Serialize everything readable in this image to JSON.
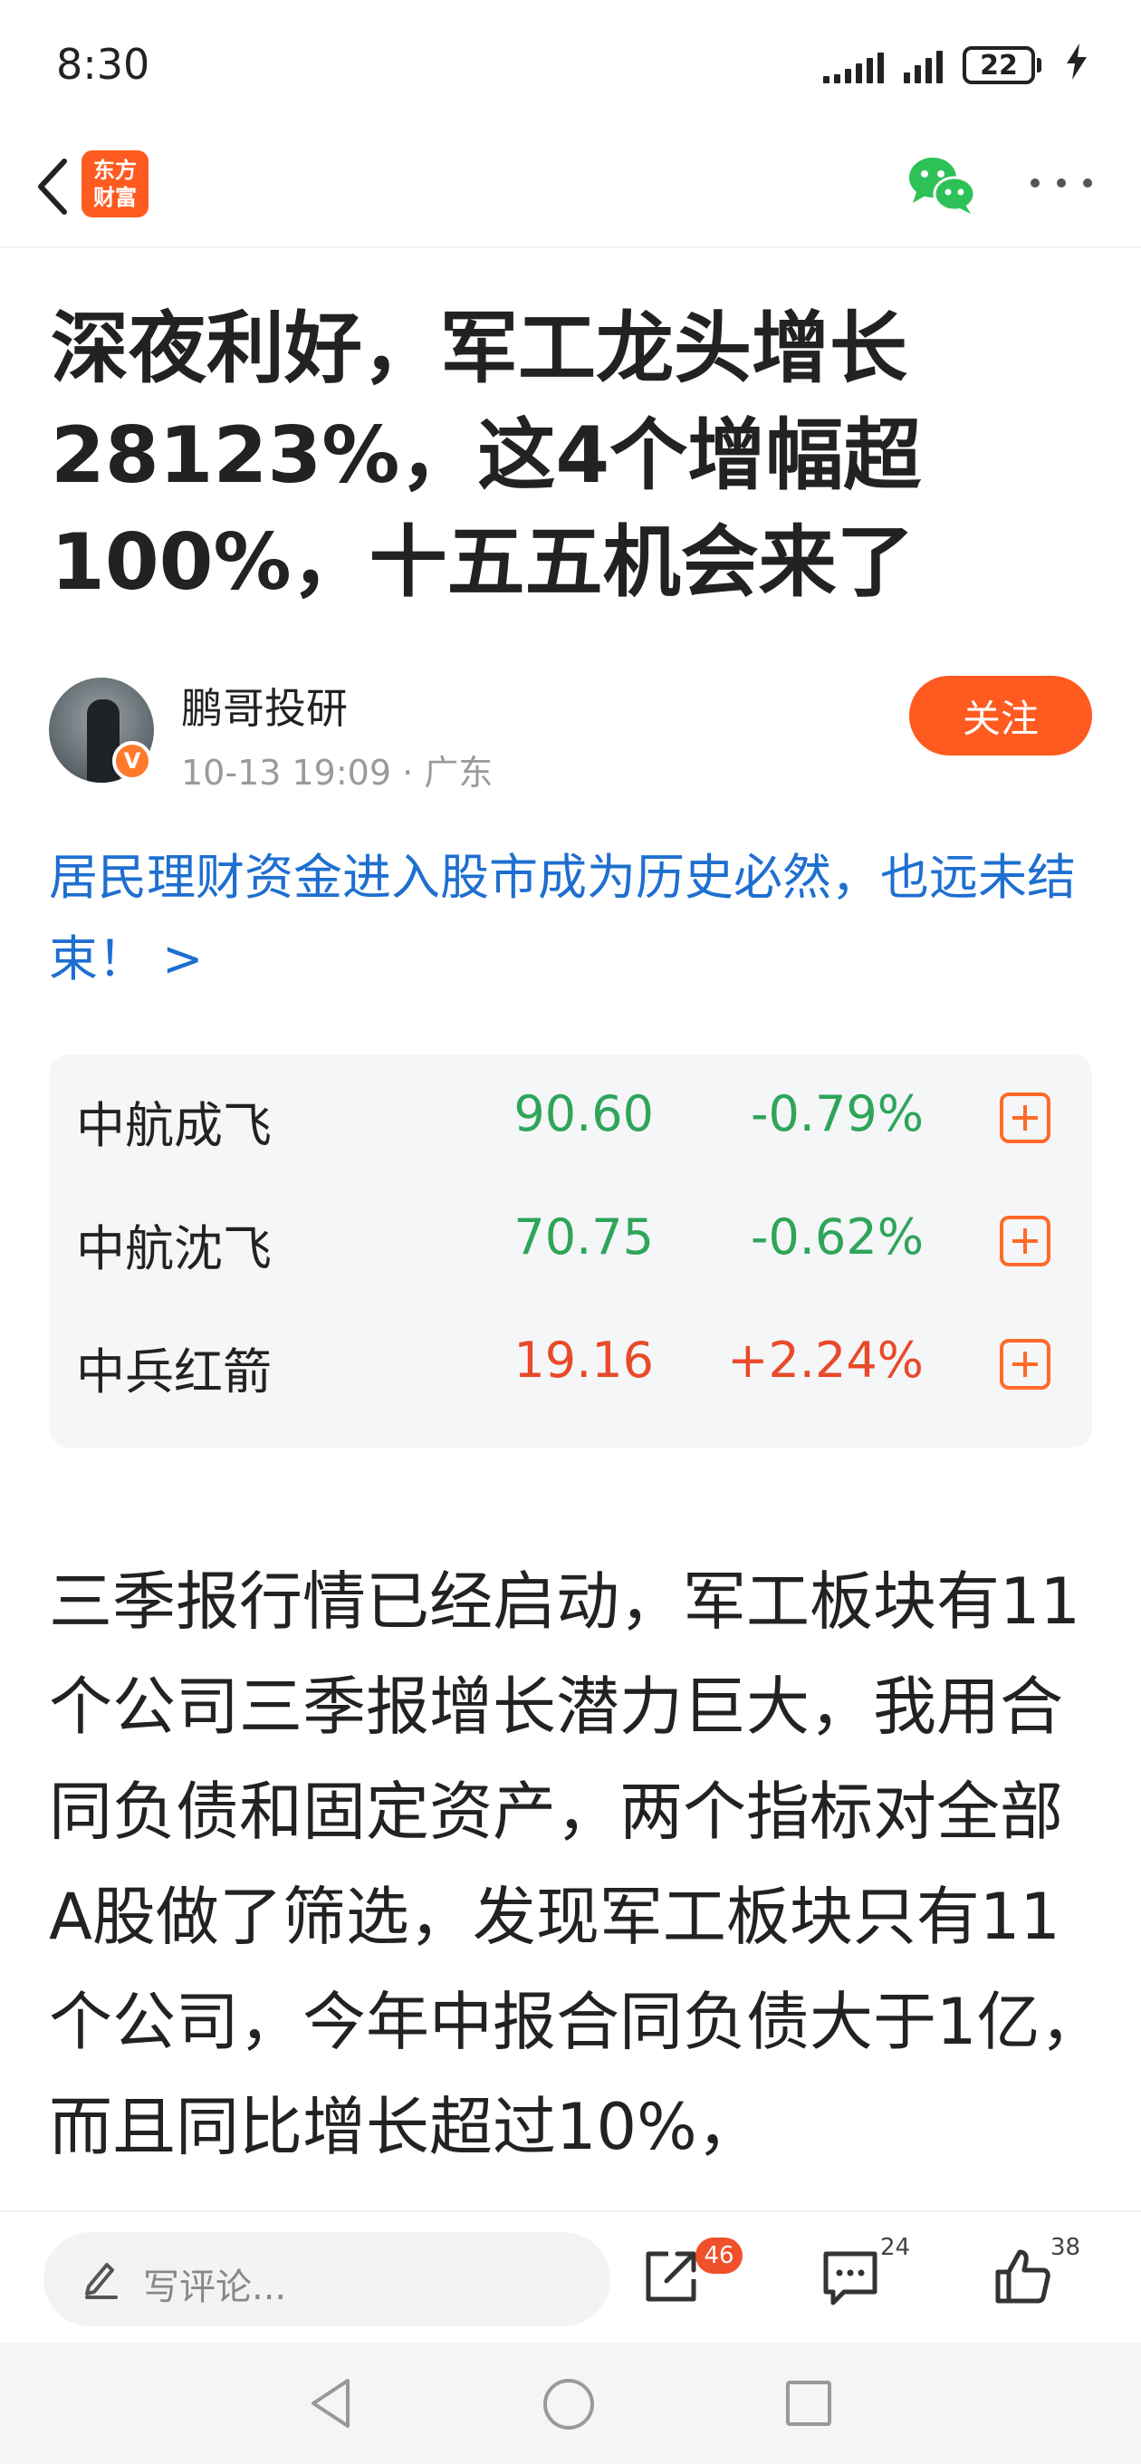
{
  "status_bar": {
    "time": "8:30",
    "battery_level": "22",
    "icons": [
      "signal-icon",
      "signal-icon",
      "battery-icon",
      "charging-icon"
    ]
  },
  "nav": {
    "logo_line1": "东方",
    "logo_line2": "财富",
    "icons": [
      "back-arrow-icon",
      "wechat-icon",
      "more-icon"
    ]
  },
  "article": {
    "title": "深夜利好，军工龙头增长28123%，这4个增幅超100%，十五五机会来了",
    "author": {
      "name": "鹏哥投研",
      "meta": "10-13 19:09 · 广东",
      "badge": "V",
      "follow_label": "关注"
    },
    "promo_link": "居民理财资金进入股市成为历史必然，也远未结束！ >",
    "body": "三季报行情已经启动，军工板块有11个公司三季报增长潜力巨大，我用合同负债和固定资产，两个指标对全部A股做了筛选，发现军工板块只有11个公司，今年中报合同负债大于1亿，而且同比增长超过10%，"
  },
  "stocks": [
    {
      "name": "中航成飞",
      "price": "90.60",
      "change": "-0.79%",
      "direction": "down"
    },
    {
      "name": "中航沈飞",
      "price": "70.75",
      "change": "-0.62%",
      "direction": "down"
    },
    {
      "name": "中兵红箭",
      "price": "19.16",
      "change": "+2.24%",
      "direction": "up"
    }
  ],
  "colors": {
    "accent": "#ff5a1f",
    "link": "#1e6fd0",
    "down": "#2ea55a",
    "up": "#e84a2a"
  },
  "bottom_bar": {
    "comment_placeholder": "写评论...",
    "share_badge": "46",
    "comment_count": "24",
    "like_count": "38"
  }
}
